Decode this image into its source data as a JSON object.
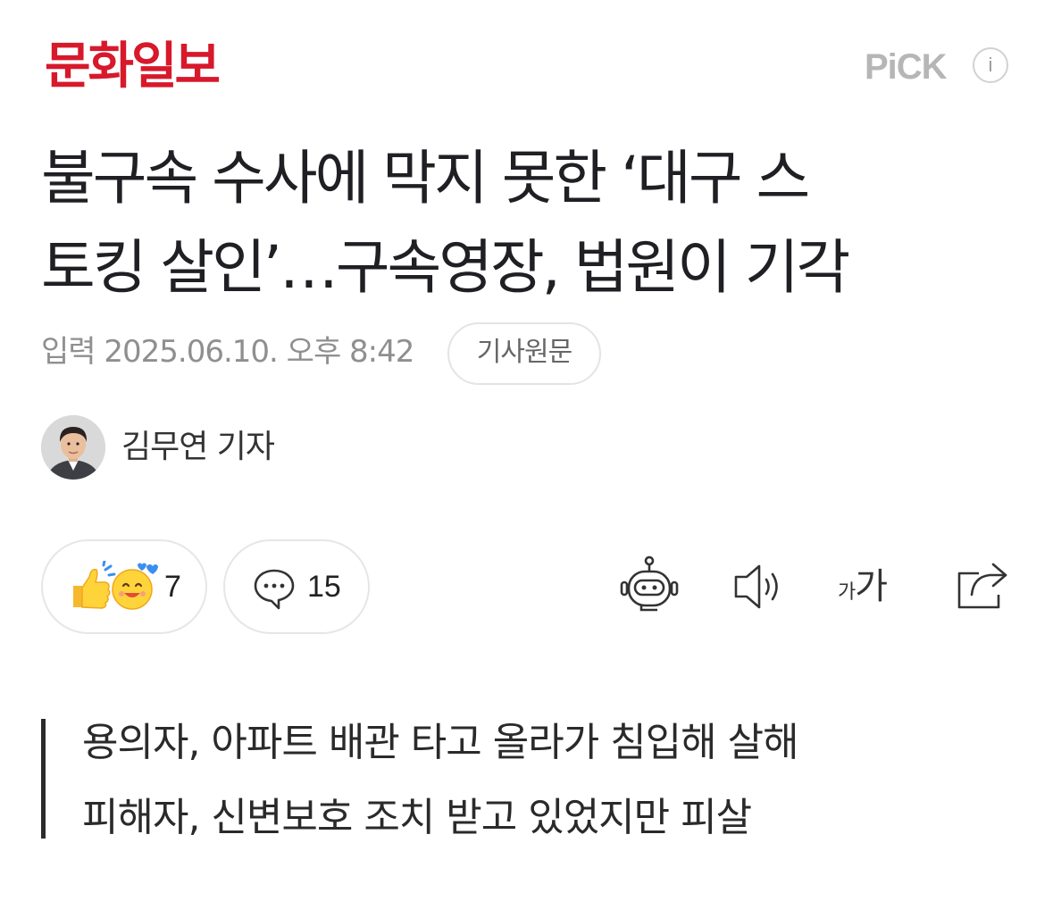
{
  "header": {
    "publisher": "문화일보",
    "pick_label": "PiCK",
    "info_label": "i"
  },
  "article": {
    "headline_line1": "불구속 수사에 막지 못한 ‘대구 스",
    "headline_line2": "토킹 살인’…구속영장, 법원이 기각",
    "published_label": "입력",
    "published_datetime": "2025.06.10. 오후 8:42",
    "original_link_label": "기사원문",
    "reporter": "김무연 기자",
    "summary": [
      "용의자, 아파트 배관 타고 올라가 침입해 살해",
      "피해자, 신변보호 조치 받고 있었지만 피살"
    ]
  },
  "reactions": {
    "count": "7",
    "icons": [
      "thumbs-up-icon",
      "smiling-face-icon"
    ]
  },
  "comments": {
    "count": "15",
    "icon": "speech-bubble-icon"
  },
  "toolbar": {
    "icons": [
      "robot-summary-icon",
      "speaker-icon",
      "font-size-icon",
      "share-icon"
    ],
    "font_size_small": "가",
    "font_size_large": "가"
  },
  "colors": {
    "brand": "#d7192b",
    "pick": "#b6b6b6",
    "meta_text": "#8f8f8f",
    "reaction_yellow": "#ffd43b"
  }
}
